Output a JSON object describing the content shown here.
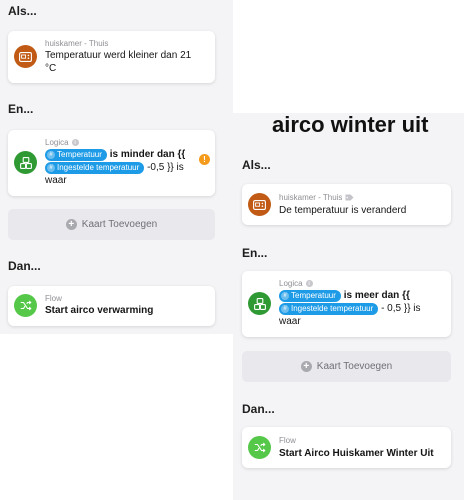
{
  "left": {
    "als_heading": "Als...",
    "trigger_card": {
      "source": "huiskamer - Thuis",
      "text": "Temperatuur werd kleiner dan 21 °C"
    },
    "en_heading": "En...",
    "logic_card": {
      "source": "Logica",
      "token1": "Temperatuur",
      "text_mid": "is minder dan  {{",
      "token2": "Ingestelde temperatuur",
      "text_tail": "-0,5 }} is waar"
    },
    "add_card_label": "Kaart Toevoegen",
    "dan_heading": "Dan...",
    "flow_card": {
      "source": "Flow",
      "text": "Start airco verwarming"
    }
  },
  "right": {
    "page_title": "airco winter uit",
    "als_heading": "Als...",
    "trigger_card": {
      "source": "huiskamer - Thuis",
      "text": "De temperatuur is veranderd"
    },
    "en_heading": "En...",
    "logic_card": {
      "source": "Logica",
      "token1": "Temperatuur",
      "text_mid": "is meer dan  {{",
      "token2": "Ingestelde temperatuur",
      "text_tail": "- 0,5 }} is waar"
    },
    "add_card_label": "Kaart Toevoegen",
    "dan_heading": "Dan...",
    "flow_card": {
      "source": "Flow",
      "text": "Start Airco Huiskamer Winter Uit"
    }
  },
  "icons": {
    "device": "thermostat-icon",
    "logic": "logic-blocks-icon",
    "flow": "flow-shuffle-icon",
    "info": "info-icon",
    "warning": "warning-icon",
    "tag": "tag-icon",
    "add": "plus-icon"
  },
  "colors": {
    "device_orange": "#c05a14",
    "logic_green": "#2f9a33",
    "flow_green": "#55c84a",
    "token_blue": "#1e9be6",
    "warning_orange": "#f59b1c"
  },
  "symbols": {
    "token_hash": "#",
    "info": "i",
    "warning": "!",
    "plus": "+"
  }
}
